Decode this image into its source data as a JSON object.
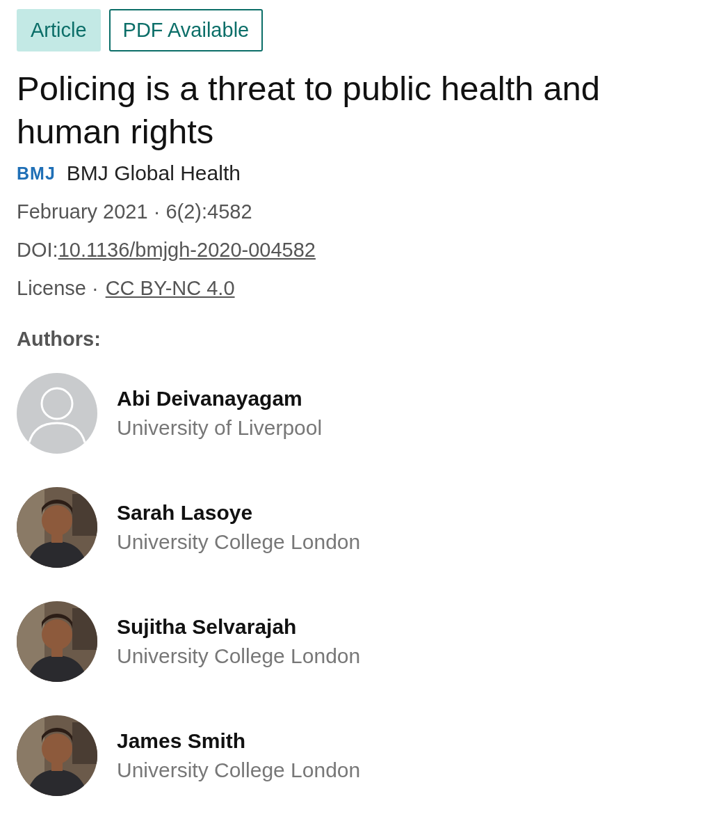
{
  "badges": [
    {
      "label": "Article",
      "kind": "filled"
    },
    {
      "label": "PDF Available",
      "kind": "outlined"
    }
  ],
  "title": "Policing is a threat to public health and human rights",
  "journal": {
    "logo": "BMJ",
    "name": "BMJ Global Health"
  },
  "date": "February 2021 · 6(2):4582",
  "doi": {
    "label": "DOI:",
    "link": "10.1136/bmjgh-2020-004582"
  },
  "license": {
    "label": "License ·",
    "link": "CC BY-NC 4.0"
  },
  "authors_label": "Authors:",
  "authors": [
    {
      "name": "Abi Deivanayagam",
      "affiliation": "University of Liverpool",
      "kind": "placeholder"
    },
    {
      "name": "Sarah Lasoye",
      "affiliation": "University College London"
    },
    {
      "name": "Sujitha Selvarajah",
      "affiliation": "University College London"
    },
    {
      "name": "James Smith",
      "affiliation": "University College London"
    }
  ]
}
